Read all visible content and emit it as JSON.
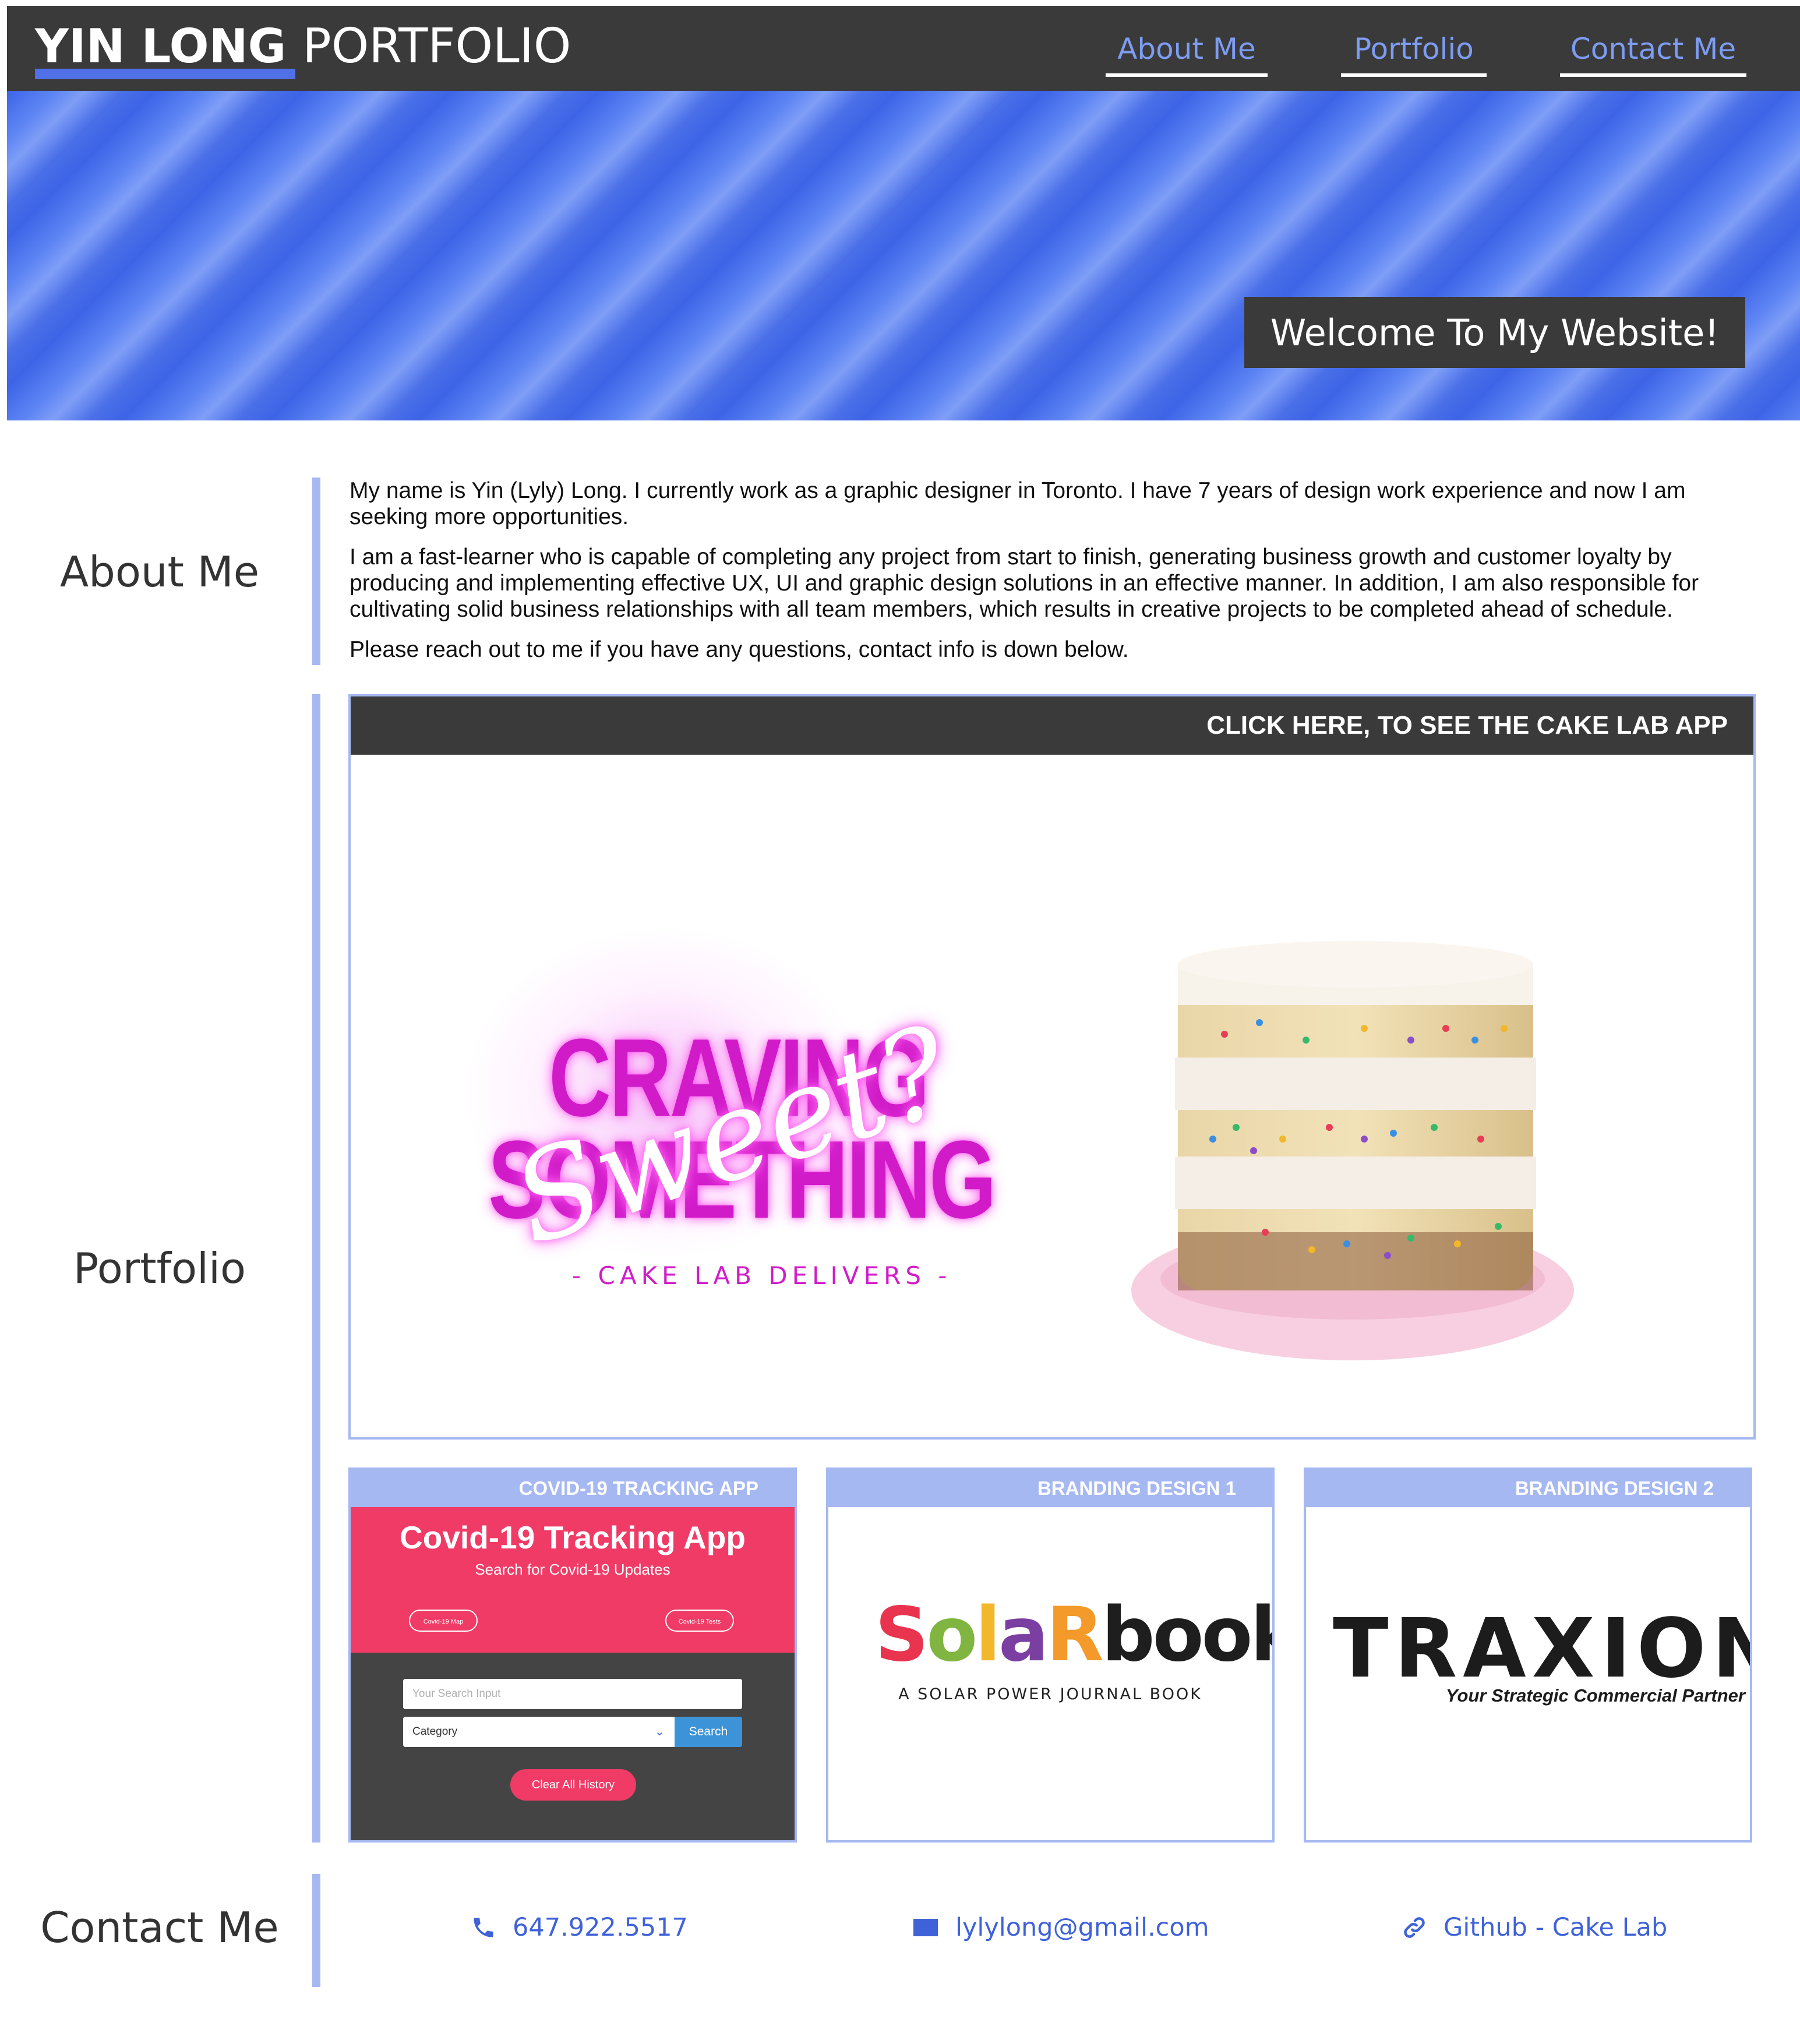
{
  "header": {
    "brand_name": "YIN LONG",
    "brand_title": "PORTFOLIO",
    "nav": [
      {
        "label": "About Me"
      },
      {
        "label": "Portfolio"
      },
      {
        "label": "Contact Me"
      }
    ]
  },
  "hero": {
    "welcome": "Welcome To My Website!"
  },
  "about": {
    "heading": "About Me",
    "paragraphs": [
      "My name is Yin (Lyly) Long. I currently work as a graphic designer in Toronto. I have 7 years of design work experience and now I am seeking more opportunities.",
      "I am a fast-learner who is capable of completing any project from start to finish, generating business growth and customer loyalty by producing and implementing effective UX, UI and graphic design solutions in an effective manner. In addition, I am also responsible for cultivating solid business relationships with all team members, which results in creative projects to be completed ahead of schedule.",
      "Please reach out to me if you have any questions, contact info is down below."
    ]
  },
  "portfolio": {
    "heading": "Portfolio",
    "featured": {
      "banner": "CLICK HERE, TO SEE THE CAKE LAB APP",
      "art_line1": "CRAVING",
      "art_line2": "SOMETHING",
      "art_script": "Sweet?",
      "art_tagline": "- CAKE LAB DELIVERS -"
    },
    "projects": [
      {
        "label": "COVID-19 TRACKING APP",
        "app_title": "Covid-19 Tracking App",
        "app_subtitle": "Search for Covid-19 Updates",
        "pill_left": "Covid-19 Map",
        "pill_right": "Covid-19 Tests",
        "search_placeholder": "Your Search Input",
        "category": "Category",
        "search_button": "Search",
        "clear_button": "Clear All History"
      },
      {
        "label": "BRANDING DESIGN 1",
        "logo_letters": [
          "S",
          "o",
          "l",
          "a",
          "R",
          "b",
          "o",
          "o",
          "k"
        ],
        "logo_colors": [
          "#e8344f",
          "#7fb540",
          "#f2b72b",
          "#7a3fa0",
          "#f39a2a",
          "#1e1e1e",
          "#1e1e1e",
          "#1e1e1e",
          "#1e1e1e"
        ],
        "tagline": "A SOLAR POWER JOURNAL BOOK"
      },
      {
        "label": "BRANDING DESIGN 2",
        "logo_word": "TRAXION",
        "tagline": "Your Strategic Commercial Partner"
      }
    ]
  },
  "contact": {
    "heading": "Contact Me",
    "phone": "647.922.5517",
    "email": "lylylong@gmail.com",
    "link": "Github - Cake Lab",
    "accent": "#3f62d8"
  },
  "colors": {
    "header_bg": "#3a3a3a",
    "brand_accent": "#4f70e6",
    "nav_link": "#7d9cf2",
    "section_bar": "#a6b8f2"
  }
}
